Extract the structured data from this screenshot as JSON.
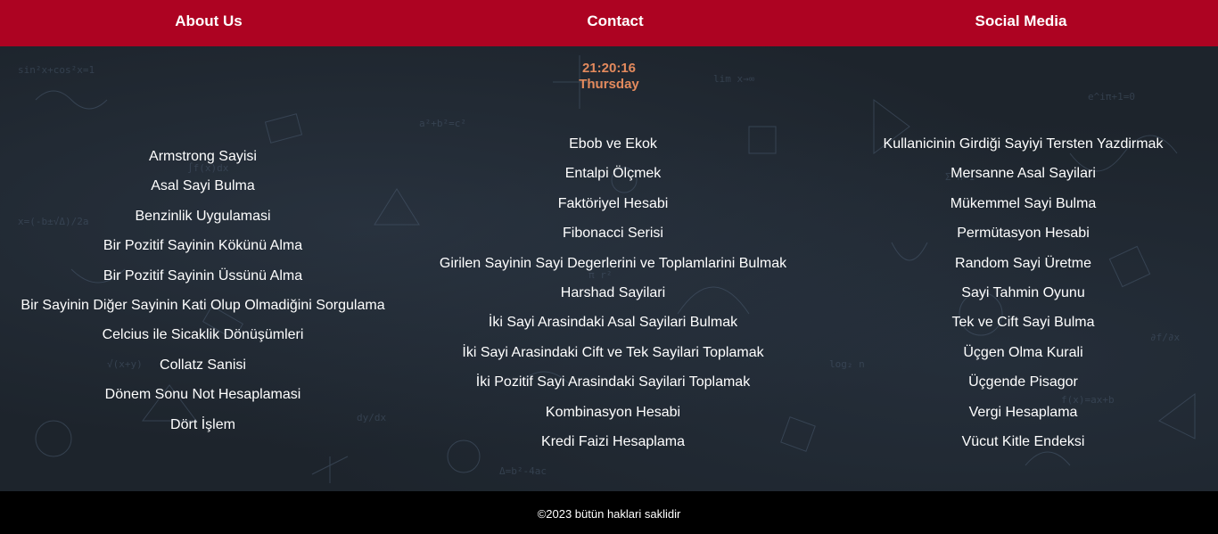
{
  "nav": {
    "about": "About Us",
    "contact": "Contact",
    "social": "Social Media"
  },
  "clock": {
    "time": "21:20:16",
    "day": "Thursday"
  },
  "columns": {
    "left": [
      "Armstrong Sayisi",
      "Asal Sayi Bulma",
      "Benzinlik Uygulamasi",
      "Bir Pozitif Sayinin Kökünü Alma",
      "Bir Pozitif Sayinin Üssünü Alma",
      "Bir Sayinin Diğer Sayinin Kati Olup Olmadiğini Sorgulama",
      "Celcius ile Sicaklik Dönüşümleri",
      "Collatz Sanisi",
      "Dönem Sonu Not Hesaplamasi",
      "Dört İşlem"
    ],
    "middle": [
      "Ebob ve Ekok",
      "Entalpi Ölçmek",
      "Faktöriyel Hesabi",
      "Fibonacci Serisi",
      "Girilen Sayinin Sayi Degerlerini ve Toplamlarini Bulmak",
      "Harshad Sayilari",
      "İki Sayi Arasindaki Asal Sayilari Bulmak",
      "İki Sayi Arasindaki Cift ve Tek Sayilari Toplamak",
      "İki Pozitif Sayi Arasindaki Sayilari Toplamak",
      "Kombinasyon Hesabi",
      "Kredi Faizi Hesaplama"
    ],
    "right": [
      "Kullanicinin Girdiği Sayiyi Tersten Yazdirmak",
      "Mersanne Asal Sayilari",
      "Mükemmel Sayi Bulma",
      "Permütasyon Hesabi",
      "Random Sayi Üretme",
      "Sayi Tahmin Oyunu",
      "Tek ve Cift Sayi Bulma",
      "Üçgen Olma Kurali",
      "Üçgende Pisagor",
      "Vergi Hesaplama",
      "Vücut Kitle Endeksi"
    ]
  },
  "footer": {
    "text": "©2023 bütün haklari saklidir"
  },
  "colors": {
    "header_bg": "#ad0322",
    "clock_text": "#e38a5d",
    "body_bg": "#1d242c",
    "footer_bg": "#000000"
  }
}
